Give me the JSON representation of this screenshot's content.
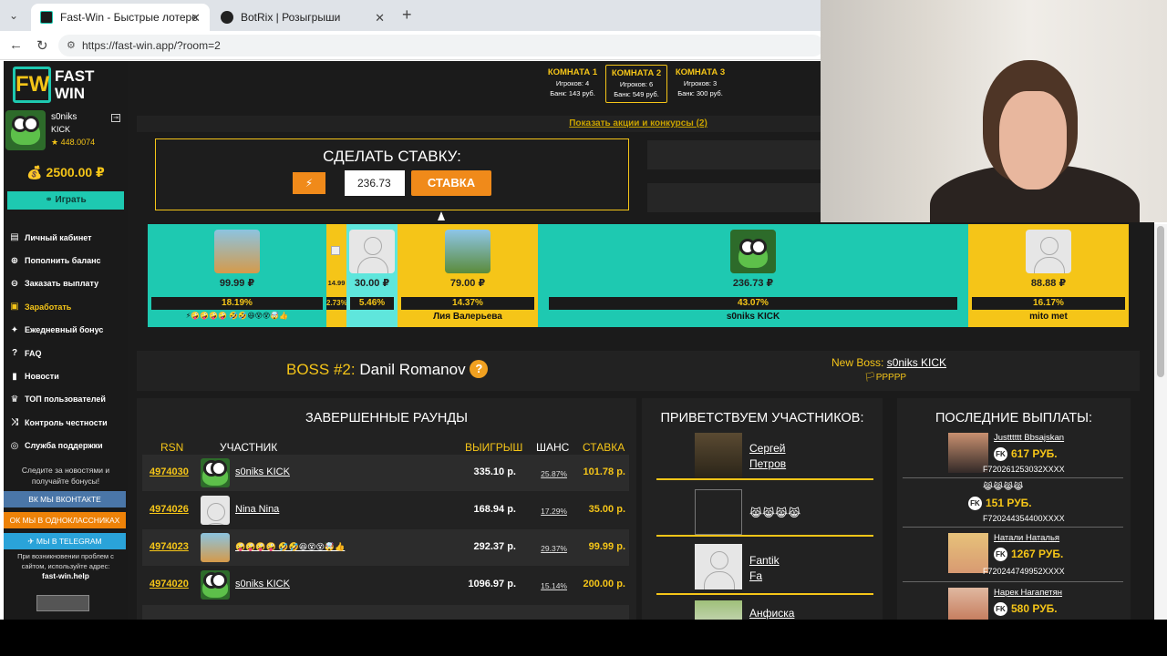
{
  "browser": {
    "tabs": [
      {
        "title": "Fast-Win - Быстрые лотереи! Ком"
      },
      {
        "title": "BotRix | Розыгрыши"
      }
    ],
    "url": "https://fast-win.app/?room=2"
  },
  "sidebar": {
    "logo": {
      "mark": "FW",
      "line1": "FAST",
      "line2": "WIN"
    },
    "user": {
      "name": "s0niks",
      "platform": "KICK",
      "points": "★ 448.0074"
    },
    "balance": "💰 2500.00 ₽",
    "play_label": "⚭ Играть",
    "menu": [
      {
        "icon": "wallet-icon",
        "glyph": "▤",
        "label": "Личный кабинет"
      },
      {
        "icon": "deposit-icon",
        "glyph": "⊕",
        "label": "Пополнить баланс"
      },
      {
        "icon": "withdraw-icon",
        "glyph": "⊖",
        "label": "Заказать выплату"
      },
      {
        "icon": "earn-icon",
        "glyph": "▣",
        "label": "Заработать"
      },
      {
        "icon": "gift-icon",
        "glyph": "✦",
        "label": "Ежедневный бонус"
      },
      {
        "icon": "faq-icon",
        "glyph": "?",
        "label": "FAQ"
      },
      {
        "icon": "bookmark-icon",
        "glyph": "▮",
        "label": "Новости"
      },
      {
        "icon": "trophy-icon",
        "glyph": "♛",
        "label": "ТОП пользователей"
      },
      {
        "icon": "shuffle-icon",
        "glyph": "⤨",
        "label": "Контроль честности"
      },
      {
        "icon": "support-icon",
        "glyph": "◎",
        "label": "Служба поддержки"
      }
    ],
    "follow_text_1": "Следите за новостями и",
    "follow_text_2": "получайте бонусы!",
    "social": [
      {
        "label": "ВК МЫ ВКОНТАКТЕ",
        "color": "#4a76a8"
      },
      {
        "label": "ОК МЫ В ОДНОКЛАССНИКАХ",
        "color": "#ee8208"
      },
      {
        "label": "✈ МЫ В TELEGRAM",
        "color": "#2aa3d9"
      }
    ],
    "trouble_1": "При возникновении проблем с",
    "trouble_2": "сайтом, используйте адрес:",
    "help_link": "fast-win.help"
  },
  "rooms": [
    {
      "name": "КОМНАТА 1",
      "players": "Игроков: 4",
      "bank": "Банк: 143 руб.",
      "active": false
    },
    {
      "name": "КОМНАТА 2",
      "players": "Игроков: 6",
      "bank": "Банк: 549 руб.",
      "active": true
    },
    {
      "name": "КОМНАТА 3",
      "players": "Игроков: 3",
      "bank": "Банк: 300 руб.",
      "active": false
    }
  ],
  "promo_link": "Показать акции и конкурсы (2)",
  "bet": {
    "title": "СДЕЛАТЬ СТАВКУ:",
    "amount": "236.73",
    "button": "СТАВКА"
  },
  "players": [
    {
      "value": "99.99 ₽",
      "percent": "18.19%",
      "name": "⚡🤪🤪🤪🤪 🤣🤣😆😵😵🤯👍",
      "color": "#1ec9b1",
      "avatar": "dog"
    },
    {
      "value": "14.99",
      "percent": "2.73%",
      "name": "",
      "color": "#f5c518",
      "avatar": "none"
    },
    {
      "value": "30.00 ₽",
      "percent": "5.46%",
      "name": "",
      "color": "#5fe6dc",
      "avatar": "gray"
    },
    {
      "value": "79.00 ₽",
      "percent": "14.37%",
      "name": "Лия Валерьева",
      "color": "#f5c518",
      "avatar": "hiker"
    },
    {
      "value": "236.73 ₽",
      "percent": "43.07%",
      "name": "s0niks KICK",
      "color": "#1ec9b1",
      "avatar": "frog"
    },
    {
      "value": "88.88 ₽",
      "percent": "16.17%",
      "name": "mito met",
      "color": "#f5c518",
      "avatar": "gray"
    }
  ],
  "boss": {
    "label": "BOSS #2:",
    "name": "Danil Romanov",
    "new_boss_label": "New Boss:",
    "new_boss_name": "s0niks KICK",
    "new_boss_flags": "🏳PPPPP"
  },
  "rounds": {
    "title": "ЗАВЕРШЕННЫЕ РАУНДЫ",
    "headers": {
      "rsn": "RSN",
      "user": "УЧАСТНИК",
      "win": "ВЫИГРЫШ",
      "chance": "ШАНС",
      "bet": "СТАВКА"
    },
    "rows": [
      {
        "id": "4974030",
        "user": "s0niks KICK",
        "win": "335.10 р.",
        "chance": "25.87%",
        "bet": "101.78 р.",
        "avatar": "frog"
      },
      {
        "id": "4974026",
        "user": "Nina Nina",
        "win": "168.94 р.",
        "chance": "17.29%",
        "bet": "35.00 р.",
        "avatar": "gray"
      },
      {
        "id": "4974023",
        "user": "🤪🤪🤪🤪 🤣🤣😆😵😵🤯👍",
        "win": "292.37 р.",
        "chance": "29.37%",
        "bet": "99.99 р.",
        "avatar": "dog"
      },
      {
        "id": "4974020",
        "user": "s0niks KICK",
        "win": "1096.97 р.",
        "chance": "15.14%",
        "bet": "200.00 р.",
        "avatar": "frog"
      }
    ]
  },
  "greet": {
    "title": "ПРИВЕТСТВУЕМ УЧАСТНИКОВ:",
    "items": [
      {
        "line1": "Сергей",
        "line2": "Петров",
        "avatar": "photo"
      },
      {
        "line1": "😹😹😹😹",
        "line2": "",
        "avatar": "none"
      },
      {
        "line1": "Fantik",
        "line2": "Fa",
        "avatar": "gray"
      },
      {
        "line1": "Анфиска",
        "line2": "",
        "avatar": "photo"
      }
    ]
  },
  "payouts": {
    "title": "ПОСЛЕДНИЕ ВЫПЛАТЫ:",
    "items": [
      {
        "name": "Justttttt Bbsajskan",
        "sum": "617 РУБ.",
        "account": "F720261253032XXXX"
      },
      {
        "name": "😹😹😹😹",
        "sum": "151 РУБ.",
        "account": "F720244354400XXXX"
      },
      {
        "name": "Натали Наталья",
        "sum": "1267 РУБ.",
        "account": "F720244749952XXXX"
      },
      {
        "name": "Нарек Нагапетян",
        "sum": "580 РУБ.",
        "account": ""
      }
    ]
  },
  "colors": {
    "accent_yellow": "#f5c518",
    "accent_teal": "#1ec9b1",
    "orange": "#f08a1a"
  }
}
